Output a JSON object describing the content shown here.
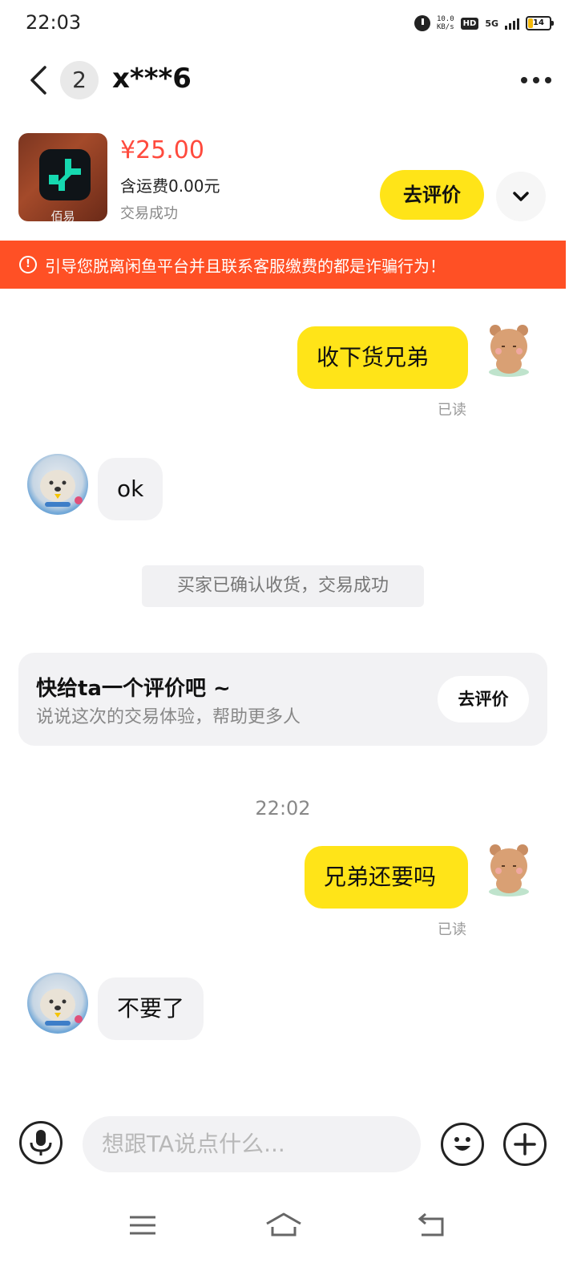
{
  "status_bar": {
    "time": "22:03",
    "net_speed_value": "10.0",
    "net_speed_unit": "KB/s",
    "hd_label": "HD",
    "network_label": "5G",
    "battery": "14"
  },
  "header": {
    "unread_count": "2",
    "title": "x***6"
  },
  "product": {
    "thumb_caption": "佰易",
    "price": "¥25.00",
    "shipping": "含运费0.00元",
    "status": "交易成功",
    "review_button": "去评价"
  },
  "warning": {
    "icon_text": "!",
    "text": "引导您脱离闲鱼平台并且联系客服缴费的都是诈骗行为！"
  },
  "messages": [
    {
      "from": "me",
      "text": "收下货兄弟",
      "read_label": "已读"
    },
    {
      "from": "other",
      "text": "ok"
    },
    {
      "from": "me",
      "text": "兄弟还要吗",
      "read_label": "已读"
    },
    {
      "from": "other",
      "text": "不要了"
    }
  ],
  "system_note": "买家已确认收货，交易成功",
  "review_card": {
    "title": "快给ta一个评价吧 ~",
    "subtitle": "说说这次的交易体验，帮助更多人",
    "button": "去评价"
  },
  "timestamp": "22:02",
  "input": {
    "placeholder": "想跟TA说点什么..."
  },
  "icons": {
    "back": "chevron-left-icon",
    "more": "more-icon",
    "expand": "chevron-down-icon",
    "mic": "microphone-icon",
    "emoji": "emoji-icon",
    "plus": "plus-icon",
    "nav_menu": "menu-icon",
    "nav_home": "home-icon",
    "nav_back": "back-icon"
  },
  "colors": {
    "accent_yellow": "#ffe418",
    "price_red": "#ff4a3d",
    "warning_orange": "#ff5025"
  }
}
